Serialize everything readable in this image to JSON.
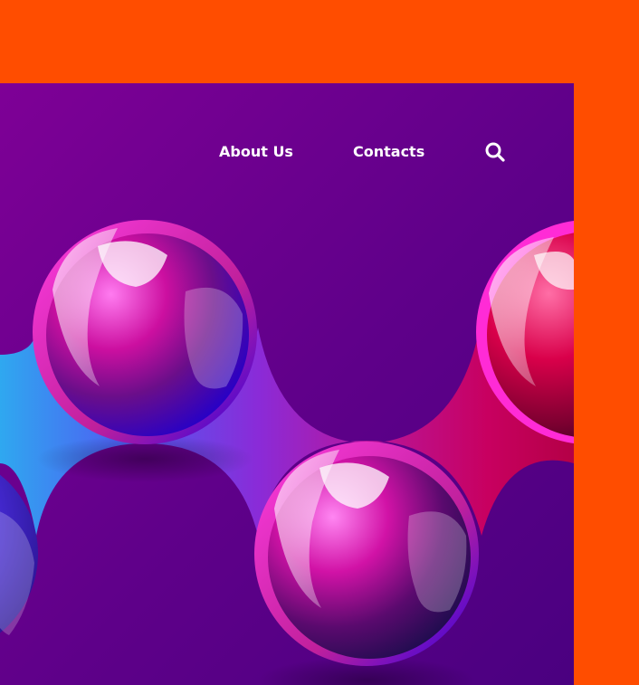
{
  "colors": {
    "frame": "#FF4D00",
    "background_start": "#7E0096",
    "background_end": "#590088",
    "nav_text": "#FFFFFF",
    "sphere_magenta": "#FF2BD6",
    "sphere_blue": "#2B00E0",
    "sphere_crimson": "#D6003C",
    "liquid_cyan": "#2FA8F0"
  },
  "nav": {
    "items": [
      {
        "label": "About Us"
      },
      {
        "label": "Contacts"
      }
    ],
    "search_icon": "search-icon"
  }
}
